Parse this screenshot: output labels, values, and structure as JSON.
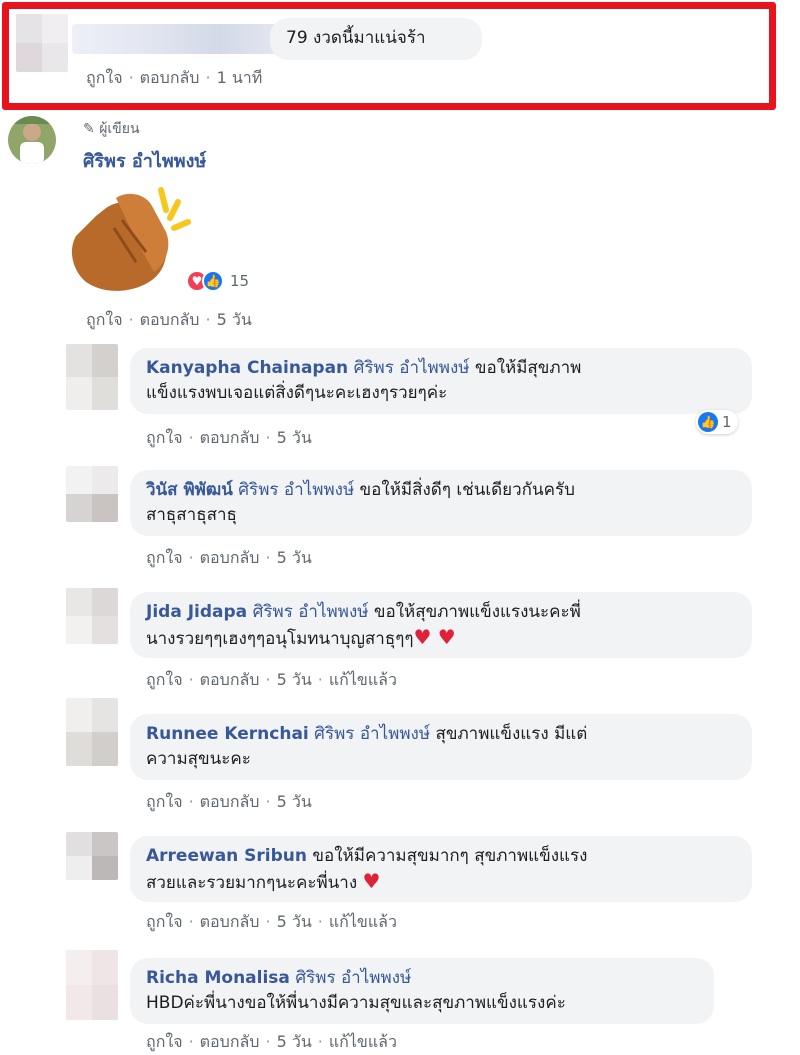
{
  "highlighted_comment": {
    "text": "79 งวดนี้มาแน่จร้า",
    "actions": [
      "ถูกใจ",
      "ตอบกลับ",
      "1 นาที"
    ]
  },
  "main_comment": {
    "badge": "ผู้เขียน",
    "author": "ศิริพร อำไพพงษ์",
    "reaction_count": "15",
    "actions": [
      "ถูกใจ",
      "ตอบกลับ",
      "5 วัน"
    ]
  },
  "replies": [
    {
      "author": "Kanyapha Chainapan",
      "tag": "ศิริพร อำไพพงษ์",
      "line1": " ขอให้มีสุขภาพ",
      "line2": "แข็งแรงพบเจอแต่สิ่งดีๆนะคะเฮงๆรวยๆค่ะ",
      "like_count": "1",
      "actions": [
        "ถูกใจ",
        "ตอบกลับ",
        "5 วัน"
      ]
    },
    {
      "author": "วินัส พิพัฒน์",
      "tag": "ศิริพร อำไพพงษ์",
      "line1": " ขอให้มีสิ่งดีๆ เช่นเดียวกันครับ",
      "line2": "สาธุสาธุสาธุ",
      "actions": [
        "ถูกใจ",
        "ตอบกลับ",
        "5 วัน"
      ]
    },
    {
      "author": "Jida Jidapa",
      "tag": "ศิริพร อำไพพงษ์",
      "line1": " ขอให้สุขภาพแข็งแรงนะคะพี่",
      "line2": "นางรวยๆๆเฮงๆๆอนุโมทนาบุญสาธุๆๆ",
      "line2_emoji": "♥ ♥",
      "actions": [
        "ถูกใจ",
        "ตอบกลับ",
        "5 วัน",
        "แก้ไขแล้ว"
      ]
    },
    {
      "author": "Runnee Kernchai",
      "tag": "ศิริพร อำไพพงษ์",
      "line1": " สุขภาพแข็งแรง มีแต่",
      "line2": "ความสุขนะคะ",
      "actions": [
        "ถูกใจ",
        "ตอบกลับ",
        "5 วัน"
      ]
    },
    {
      "author": "Arreewan Sribun",
      "tag": "",
      "line1": " ขอให้มีความสุขมากๆ สุขภาพแข็งแรง",
      "line2": "สวยและรวยมากๆนะคะพี่นาง ",
      "line2_emoji": "♥",
      "actions": [
        "ถูกใจ",
        "ตอบกลับ",
        "5 วัน",
        "แก้ไขแล้ว"
      ]
    },
    {
      "author": "Richa Monalisa",
      "tag": "ศิริพร อำไพพงษ์",
      "line1": "",
      "line2": "HBDค่ะพี่นางขอให้พี่นางมีความสุขและสุขภาพแข็งแรงค่ะ",
      "actions": [
        "ถูกใจ",
        "ตอบกลับ",
        "5 วัน",
        "แก้ไขแล้ว"
      ]
    }
  ],
  "colors": {
    "highlight": "#e8131e",
    "name_link": "#385898",
    "bubble_bg": "#f2f3f5",
    "meta_text": "#606770"
  }
}
